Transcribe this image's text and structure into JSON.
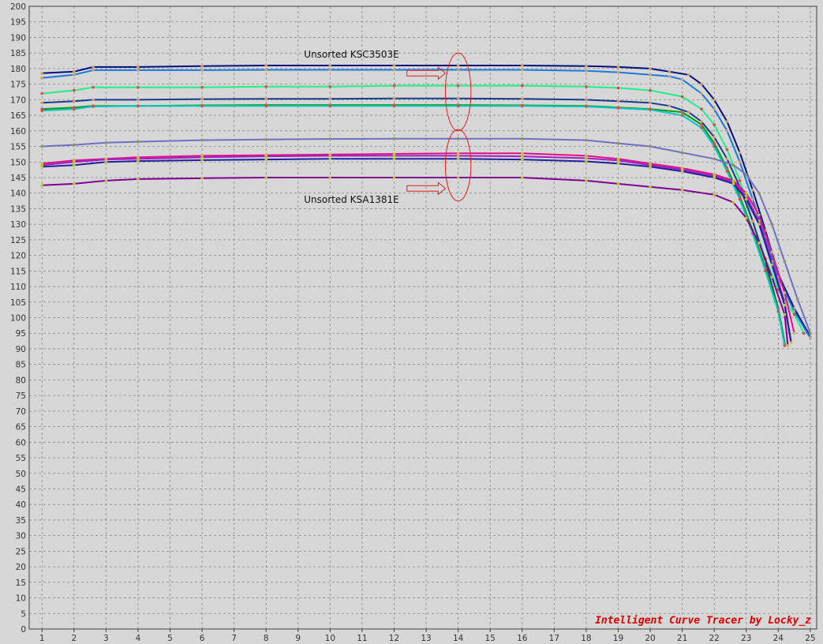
{
  "credit": "Intelligent Curve Tracer by Locky_z",
  "colors": {
    "background": "#d7d7d7",
    "grid": "#8a8a8a",
    "annotation": "#e02020",
    "credit": "#dd0000"
  },
  "chart_data": {
    "type": "line",
    "title": "",
    "xlabel": "",
    "ylabel": "",
    "xlim": [
      0.6,
      25.2
    ],
    "ylim": [
      0,
      200
    ],
    "xticks": [
      1,
      2,
      3,
      4,
      5,
      6,
      7,
      8,
      9,
      10,
      11,
      12,
      13,
      14,
      15,
      16,
      17,
      18,
      19,
      20,
      21,
      22,
      23,
      24,
      25
    ],
    "yticks": [
      0,
      5,
      10,
      15,
      20,
      25,
      30,
      35,
      40,
      45,
      50,
      55,
      60,
      65,
      70,
      75,
      80,
      85,
      90,
      95,
      100,
      105,
      110,
      115,
      120,
      125,
      130,
      135,
      140,
      145,
      150,
      155,
      160,
      165,
      170,
      175,
      180,
      185,
      190,
      195,
      200
    ],
    "grid": true,
    "legend": "none",
    "annotations": [
      {
        "text": "Unsorted KSC3503E",
        "ellipse_center": [
          14,
          172.5
        ],
        "ellipse_radius": [
          0.4,
          12.5
        ],
        "arrow_from": [
          12.4,
          178.5
        ],
        "arrow_to": [
          13.6,
          178.5
        ]
      },
      {
        "text": "Unsorted KSA1381E",
        "ellipse_center": [
          14,
          149
        ],
        "ellipse_radius": [
          0.4,
          11.5
        ],
        "arrow_from": [
          12.4,
          141.5
        ],
        "arrow_to": [
          13.6,
          141.5
        ]
      }
    ],
    "series": [
      {
        "color": "#00107a",
        "marker": "#c8a070",
        "points": [
          [
            1,
            178.5
          ],
          [
            2,
            179
          ],
          [
            2.6,
            180.5
          ],
          [
            4,
            180.5
          ],
          [
            6,
            180.8
          ],
          [
            8,
            181
          ],
          [
            10,
            181
          ],
          [
            12,
            181
          ],
          [
            14,
            181
          ],
          [
            16,
            181
          ],
          [
            18,
            180.8
          ],
          [
            19,
            180.5
          ],
          [
            20,
            180
          ],
          [
            20.6,
            179
          ],
          [
            21.2,
            178
          ],
          [
            21.6,
            175
          ],
          [
            22,
            170
          ],
          [
            22.4,
            163
          ],
          [
            22.8,
            153
          ],
          [
            23.2,
            141
          ],
          [
            23.6,
            128
          ],
          [
            24,
            114
          ],
          [
            24.5,
            103
          ],
          [
            25,
            94
          ]
        ]
      },
      {
        "color": "#1a78e0",
        "marker": "#c8a070",
        "points": [
          [
            1,
            177
          ],
          [
            2,
            178
          ],
          [
            2.6,
            179.5
          ],
          [
            4,
            179.5
          ],
          [
            6,
            179.5
          ],
          [
            8,
            179.6
          ],
          [
            10,
            179.6
          ],
          [
            12,
            179.6
          ],
          [
            14,
            179.6
          ],
          [
            16,
            179.6
          ],
          [
            18,
            179.3
          ],
          [
            19,
            178.8
          ],
          [
            20,
            178
          ],
          [
            20.6,
            177.5
          ],
          [
            21,
            176.5
          ],
          [
            21.6,
            172
          ],
          [
            22,
            167
          ],
          [
            22.4,
            160
          ],
          [
            22.8,
            150
          ],
          [
            23.2,
            138
          ],
          [
            23.6,
            126
          ],
          [
            24,
            113
          ],
          [
            24.5,
            102
          ],
          [
            25,
            93.5
          ]
        ]
      },
      {
        "color": "#22ee88",
        "marker": "#d05050",
        "points": [
          [
            1,
            172
          ],
          [
            2,
            173
          ],
          [
            2.6,
            174
          ],
          [
            4,
            174
          ],
          [
            6,
            174
          ],
          [
            8,
            174.2
          ],
          [
            10,
            174.2
          ],
          [
            12,
            174.5
          ],
          [
            14,
            174.5
          ],
          [
            16,
            174.5
          ],
          [
            18,
            174.2
          ],
          [
            19,
            173.8
          ],
          [
            20,
            173
          ],
          [
            21,
            171
          ],
          [
            21.6,
            167
          ],
          [
            22,
            162
          ],
          [
            22.4,
            154
          ],
          [
            22.8,
            144
          ],
          [
            23.2,
            131
          ],
          [
            23.6,
            119
          ],
          [
            24,
            109
          ],
          [
            24.5,
            101
          ],
          [
            24.8,
            95
          ]
        ]
      },
      {
        "color": "#1a3a8a",
        "marker": "#c8a070",
        "points": [
          [
            1,
            169
          ],
          [
            2,
            169.5
          ],
          [
            2.6,
            170
          ],
          [
            4,
            170
          ],
          [
            6,
            170.2
          ],
          [
            8,
            170.3
          ],
          [
            10,
            170.3
          ],
          [
            12,
            170.4
          ],
          [
            14,
            170.4
          ],
          [
            16,
            170.3
          ],
          [
            18,
            170
          ],
          [
            19,
            169.5
          ],
          [
            20,
            169
          ],
          [
            20.6,
            168
          ],
          [
            21.2,
            166
          ],
          [
            21.6,
            163
          ],
          [
            22,
            158
          ],
          [
            22.4,
            151
          ],
          [
            22.8,
            142
          ],
          [
            23.2,
            131
          ],
          [
            23.6,
            118
          ],
          [
            24,
            103
          ],
          [
            24.2,
            92
          ]
        ]
      },
      {
        "color": "#0a9a0a",
        "marker": "#d05050",
        "points": [
          [
            1,
            167
          ],
          [
            2,
            167.5
          ],
          [
            2.6,
            168
          ],
          [
            4,
            168
          ],
          [
            6,
            168.2
          ],
          [
            8,
            168.3
          ],
          [
            10,
            168.3
          ],
          [
            12,
            168.3
          ],
          [
            14,
            168.3
          ],
          [
            16,
            168.2
          ],
          [
            18,
            168
          ],
          [
            19,
            167.5
          ],
          [
            20,
            167
          ],
          [
            21,
            166
          ],
          [
            21.6,
            162
          ],
          [
            22,
            156
          ],
          [
            22.4,
            148
          ],
          [
            22.8,
            139
          ],
          [
            23.2,
            128
          ],
          [
            23.6,
            116
          ],
          [
            24,
            103
          ],
          [
            24.2,
            91.5
          ]
        ]
      },
      {
        "color": "#00c8c8",
        "marker": "#d05050",
        "points": [
          [
            1,
            166.5
          ],
          [
            2,
            167
          ],
          [
            2.6,
            167.8
          ],
          [
            4,
            168
          ],
          [
            6,
            168
          ],
          [
            8,
            168
          ],
          [
            10,
            168
          ],
          [
            12,
            168
          ],
          [
            14,
            168
          ],
          [
            16,
            168
          ],
          [
            18,
            167.8
          ],
          [
            19,
            167.3
          ],
          [
            20,
            166.8
          ],
          [
            21,
            165
          ],
          [
            21.6,
            161
          ],
          [
            22,
            155
          ],
          [
            22.4,
            147
          ],
          [
            22.8,
            138
          ],
          [
            23.2,
            127
          ],
          [
            23.6,
            115
          ],
          [
            24,
            102
          ],
          [
            24.2,
            91
          ]
        ]
      },
      {
        "color": "#7070c0",
        "marker": "#909060",
        "points": [
          [
            1,
            155
          ],
          [
            2,
            155.5
          ],
          [
            3,
            156.2
          ],
          [
            4,
            156.5
          ],
          [
            6,
            157
          ],
          [
            8,
            157.2
          ],
          [
            10,
            157.4
          ],
          [
            12,
            157.5
          ],
          [
            14,
            157.5
          ],
          [
            16,
            157.5
          ],
          [
            18,
            157
          ],
          [
            19,
            156
          ],
          [
            20,
            155
          ],
          [
            21,
            153
          ],
          [
            22,
            151
          ],
          [
            22.6,
            149
          ],
          [
            23,
            146
          ],
          [
            23.4,
            140
          ],
          [
            23.8,
            130
          ],
          [
            24.2,
            118
          ],
          [
            24.6,
            106
          ],
          [
            25,
            95
          ]
        ]
      },
      {
        "color": "#e0108a",
        "marker": "#c0c040",
        "points": [
          [
            1,
            149.5
          ],
          [
            2,
            150.5
          ],
          [
            3,
            151
          ],
          [
            4,
            151.5
          ],
          [
            6,
            152
          ],
          [
            8,
            152.2
          ],
          [
            10,
            152.4
          ],
          [
            12,
            152.6
          ],
          [
            14,
            152.8
          ],
          [
            16,
            152.8
          ],
          [
            18,
            152
          ],
          [
            19,
            151
          ],
          [
            20,
            149.5
          ],
          [
            21,
            148
          ],
          [
            22,
            146
          ],
          [
            22.6,
            144
          ],
          [
            23,
            140
          ],
          [
            23.4,
            133
          ],
          [
            23.8,
            121
          ],
          [
            24.2,
            108
          ],
          [
            24.5,
            95
          ]
        ]
      },
      {
        "color": "#a020c0",
        "marker": "#c0c040",
        "points": [
          [
            1,
            149
          ],
          [
            2,
            150
          ],
          [
            3,
            150.8
          ],
          [
            4,
            151
          ],
          [
            6,
            151.5
          ],
          [
            8,
            151.8
          ],
          [
            10,
            152
          ],
          [
            12,
            152
          ],
          [
            14,
            152
          ],
          [
            16,
            151.8
          ],
          [
            18,
            151.2
          ],
          [
            19,
            150.5
          ],
          [
            20,
            149
          ],
          [
            21,
            147.5
          ],
          [
            22,
            145.5
          ],
          [
            22.6,
            143.5
          ],
          [
            23,
            139
          ],
          [
            23.4,
            131
          ],
          [
            23.8,
            118
          ],
          [
            24.2,
            105
          ],
          [
            24.4,
            92.5
          ]
        ]
      },
      {
        "color": "#2020a0",
        "marker": "#c0c040",
        "points": [
          [
            1,
            148.5
          ],
          [
            2,
            149
          ],
          [
            3,
            150
          ],
          [
            4,
            150.3
          ],
          [
            6,
            150.6
          ],
          [
            8,
            150.8
          ],
          [
            10,
            151
          ],
          [
            12,
            151
          ],
          [
            14,
            151
          ],
          [
            16,
            150.8
          ],
          [
            18,
            150.2
          ],
          [
            19,
            149.5
          ],
          [
            20,
            148.5
          ],
          [
            21,
            147
          ],
          [
            22,
            145
          ],
          [
            22.6,
            143
          ],
          [
            23,
            138
          ],
          [
            23.4,
            130
          ],
          [
            23.8,
            117
          ],
          [
            24.2,
            104
          ],
          [
            24.4,
            92
          ]
        ]
      },
      {
        "color": "#800090",
        "marker": "#c0c040",
        "points": [
          [
            1,
            142.5
          ],
          [
            2,
            143
          ],
          [
            3,
            144
          ],
          [
            4,
            144.5
          ],
          [
            6,
            144.8
          ],
          [
            8,
            145
          ],
          [
            10,
            145
          ],
          [
            12,
            145
          ],
          [
            14,
            145
          ],
          [
            16,
            145
          ],
          [
            18,
            144
          ],
          [
            19,
            143
          ],
          [
            20,
            142
          ],
          [
            21,
            141
          ],
          [
            22,
            139.5
          ],
          [
            22.6,
            137
          ],
          [
            23,
            132
          ],
          [
            23.4,
            124
          ],
          [
            23.8,
            113
          ],
          [
            24.2,
            101
          ],
          [
            24.3,
            91
          ]
        ]
      }
    ]
  }
}
